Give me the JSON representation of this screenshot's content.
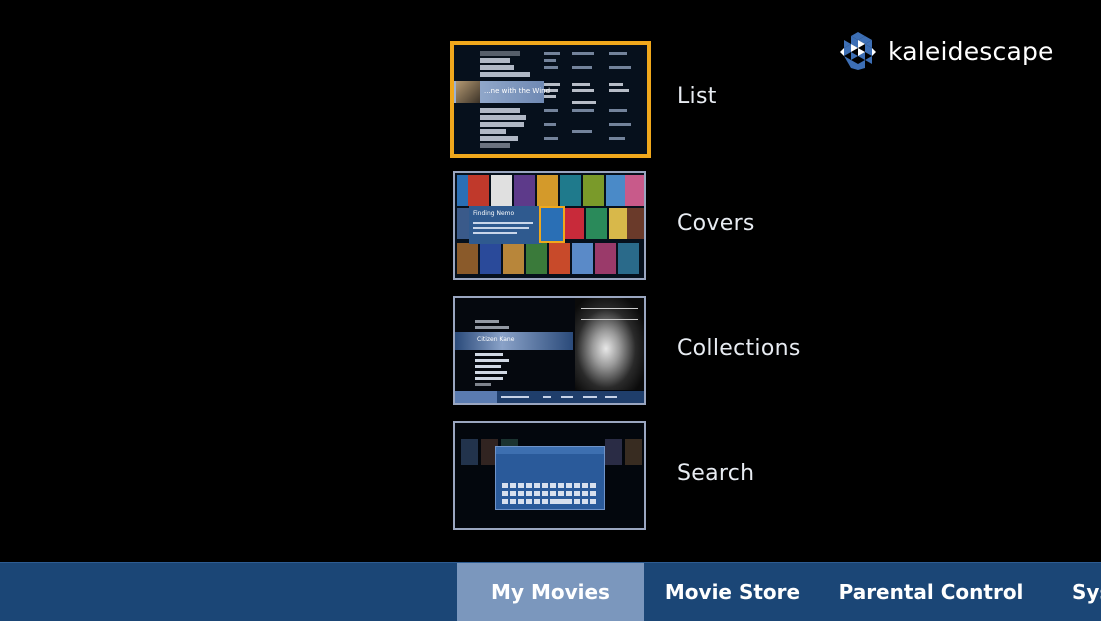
{
  "brand": {
    "name": "kaleidescape"
  },
  "views": [
    {
      "label": "List",
      "selected": true
    },
    {
      "label": "Covers",
      "selected": false
    },
    {
      "label": "Collections",
      "selected": false
    },
    {
      "label": "Search",
      "selected": false
    }
  ],
  "thumbnails": {
    "list_highlight": "...ne with the Wind",
    "covers_panel_title": "Finding Nemo",
    "collections_highlight": "Citizen Kane"
  },
  "nav": {
    "tabs": [
      {
        "label": "My Movies",
        "active": true
      },
      {
        "label": "Movie Store",
        "active": false
      },
      {
        "label": "Parental Control",
        "active": false
      },
      {
        "label": "Sys",
        "active": false
      }
    ]
  },
  "colors": {
    "selection": "#f0a81c",
    "nav_bar": "#1b4676",
    "nav_active": "#7b97bd",
    "background": "#000000"
  }
}
